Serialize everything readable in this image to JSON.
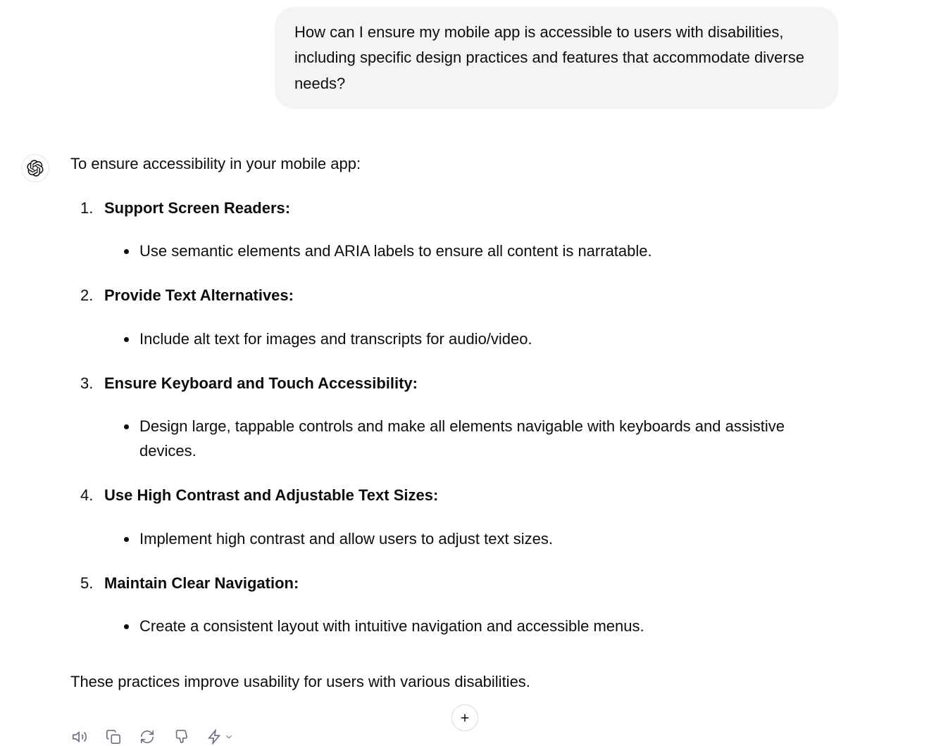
{
  "user_message": "How can I ensure my mobile app is accessible to users with disabilities, including specific design practices and features that accommodate diverse needs?",
  "assistant": {
    "intro": "To ensure accessibility in your mobile app:",
    "items": [
      {
        "title": "Support Screen Readers:",
        "detail": "Use semantic elements and ARIA labels to ensure all content is narratable."
      },
      {
        "title": "Provide Text Alternatives:",
        "detail": "Include alt text for images and transcripts for audio/video."
      },
      {
        "title": "Ensure Keyboard and Touch Accessibility:",
        "detail": "Design large, tappable controls and make all elements navigable with keyboards and assistive devices."
      },
      {
        "title": "Use High Contrast and Adjustable Text Sizes:",
        "detail": "Implement high contrast and allow users to adjust text sizes."
      },
      {
        "title": "Maintain Clear Navigation:",
        "detail": "Create a consistent layout with intuitive navigation and accessible menus."
      }
    ],
    "closing": "These practices improve usability for users with various disabilities."
  },
  "icons": {
    "avatar": "chatgpt-logo",
    "read_aloud": "speaker-icon",
    "copy": "copy-icon",
    "regenerate": "refresh-icon",
    "dislike": "thumbs-down-icon",
    "model": "lightning-icon",
    "attach": "plus-icon"
  }
}
